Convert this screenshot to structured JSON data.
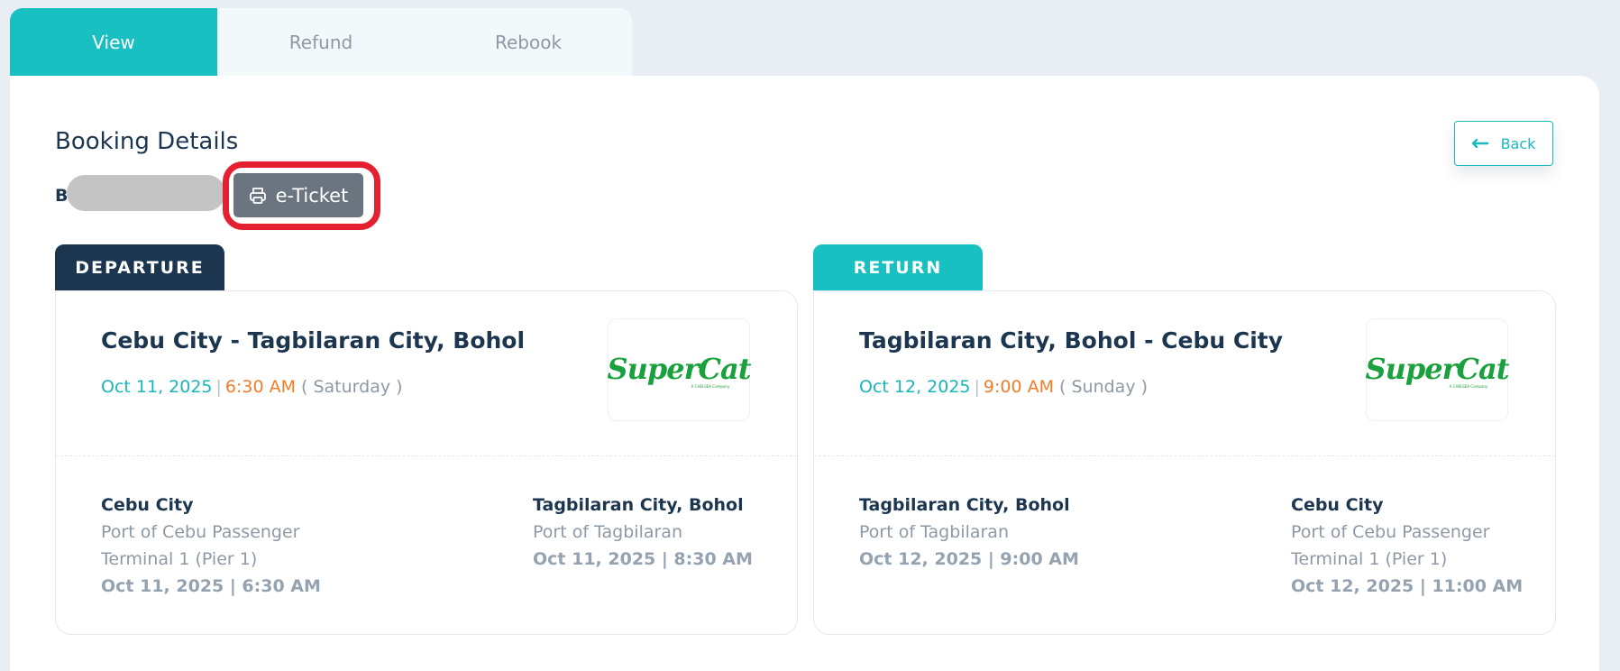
{
  "tabs": [
    {
      "label": "View",
      "active": true
    },
    {
      "label": "Refund",
      "active": false
    },
    {
      "label": "Rebook",
      "active": false
    }
  ],
  "page_title": "Booking Details",
  "back_label": "Back",
  "booking_prefix": "B",
  "eticket_label": "e-Ticket",
  "departure": {
    "tag": "DEPARTURE",
    "route": "Cebu City - Tagbilaran City, Bohol",
    "date": "Oct 11, 2025",
    "time": "6:30 AM",
    "day": "( Saturday )",
    "carrier": "SuperCat",
    "carrier_sub": "A CHELSEA Company",
    "origin": {
      "city": "Cebu City",
      "port": "Port of Cebu Passenger Terminal 1 (Pier 1)",
      "when": "Oct 11, 2025 | 6:30 AM"
    },
    "destination": {
      "city": "Tagbilaran City, Bohol",
      "port": "Port of Tagbilaran",
      "when": "Oct 11, 2025 | 8:30 AM"
    }
  },
  "return": {
    "tag": "RETURN",
    "route": "Tagbilaran City, Bohol - Cebu City",
    "date": "Oct 12, 2025",
    "time": "9:00 AM",
    "day": "( Sunday )",
    "carrier": "SuperCat",
    "carrier_sub": "A CHELSEA Company",
    "origin": {
      "city": "Tagbilaran City, Bohol",
      "port": "Port of Tagbilaran",
      "when": "Oct 12, 2025 | 9:00 AM"
    },
    "destination": {
      "city": "Cebu City",
      "port": "Port of Cebu Passenger Terminal 1 (Pier 1)",
      "when": "Oct 12, 2025 | 11:00 AM"
    }
  },
  "colors": {
    "accent": "#19c0c2",
    "navy": "#1c3650",
    "time_orange": "#f07d2a",
    "highlight_red": "#e52030",
    "carrier_green": "#1aa03c"
  }
}
